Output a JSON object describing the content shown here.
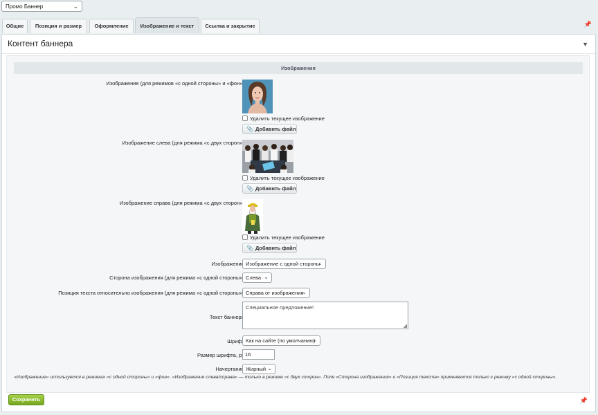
{
  "header": {
    "profile_select": "Промо Баннер"
  },
  "tabs": [
    {
      "label": "Общие"
    },
    {
      "label": "Позиция и размер"
    },
    {
      "label": "Оформление"
    },
    {
      "label": "Изображение и текст"
    },
    {
      "label": "Ссылка и закрытие"
    }
  ],
  "active_tab_index": 3,
  "panel": {
    "title": "Контент баннера",
    "section_title": "Изображения"
  },
  "images": {
    "main": {
      "label": "Изображение (для режимов «с одной стороны» и «фон»):",
      "delete_label": "Удалить текущее изображение",
      "add_label": "Добавить файл"
    },
    "left": {
      "label": "Изображение слева (для режима «с двух сторон»):",
      "delete_label": "Удалить текущее изображение",
      "add_label": "Добавить файл"
    },
    "right": {
      "label": "Изображение справа (для режима «с двух сторон»):",
      "delete_label": "Удалить текущее изображение",
      "add_label": "Добавить файл"
    }
  },
  "fields": {
    "image_mode": {
      "label": "Изображение:",
      "value": "Изображение с одной стороны"
    },
    "image_side": {
      "label": "Сторона изображения (для режима «с одной стороны»):",
      "value": "Слева"
    },
    "text_position": {
      "label": "Позиция текста относительно изображения (для режима «с одной стороны»):",
      "value": "Справа от изображения"
    },
    "banner_text": {
      "label": "Текст баннера:",
      "value": "Специальное предложение!"
    },
    "font": {
      "label": "Шрифт:",
      "value": "Как на сайте (по умолчанию)"
    },
    "font_size": {
      "label": "Размер шрифта, px:",
      "value": "16"
    },
    "font_style": {
      "label": "Начертание:",
      "value": "Жирный"
    }
  },
  "note": "«Изображение» используется в режимах «с одной стороны» и «фон». «Изображение слева/справа» — только в режиме «с двух сторон». Поля «Сторона изображения» и «Позиция текста» применяются только к режиму «с одной стороны».",
  "actions": {
    "save_label": "Сохранить"
  },
  "colors": {
    "accent_green": "#8cc033",
    "page_bg": "#e9eef0"
  }
}
